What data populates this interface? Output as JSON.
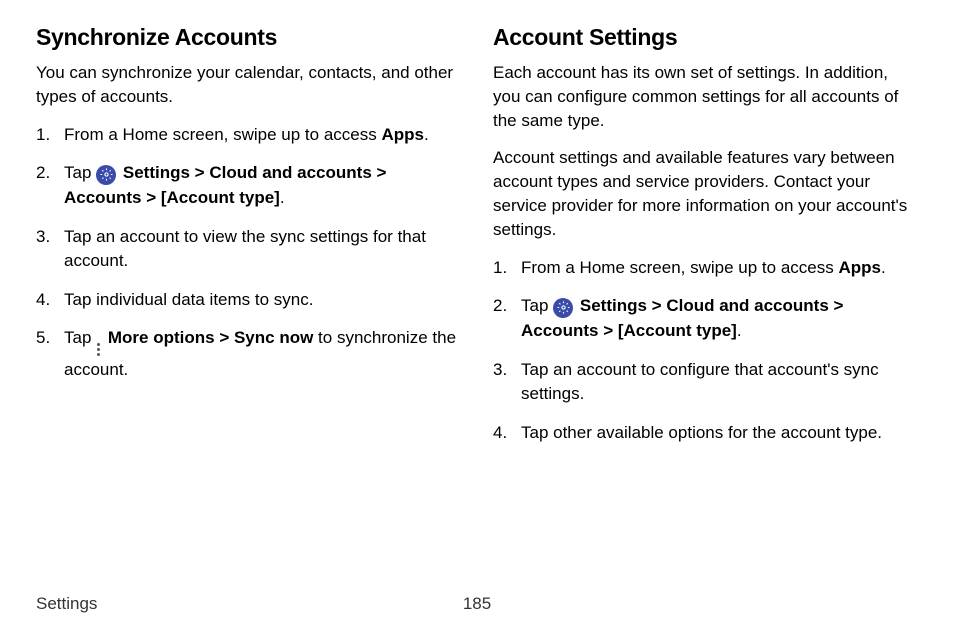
{
  "left": {
    "heading": "Synchronize Accounts",
    "intro": "You can synchronize your calendar, contacts, and other types of accounts.",
    "steps": {
      "s1_pre": "From a Home screen, swipe up to access ",
      "s1_bold": "Apps",
      "s1_post": ".",
      "s2_pre": "Tap ",
      "s2_settings": "Settings",
      "s2_sep1": " > ",
      "s2_cloud": "Cloud and accounts",
      "s2_sep2": " > ",
      "s2_accounts": "Accounts",
      "s2_sep3": " > ",
      "s2_type": "[Account type]",
      "s2_post": ".",
      "s3": "Tap an account to view the sync settings for that account.",
      "s4": "Tap individual data items to sync.",
      "s5_pre": "Tap ",
      "s5_more": "More options",
      "s5_sep": " > ",
      "s5_sync": "Sync now",
      "s5_post": " to synchronize the account."
    }
  },
  "right": {
    "heading": "Account Settings",
    "intro1": "Each account has its own set of settings. In addition, you can configure common settings for all accounts of the same type.",
    "intro2": "Account settings and available features vary between account types and service providers. Contact your service provider for more information on your account's settings.",
    "steps": {
      "s1_pre": "From a Home screen, swipe up to access ",
      "s1_bold": "Apps",
      "s1_post": ".",
      "s2_pre": "Tap ",
      "s2_settings": "Settings",
      "s2_sep1": " > ",
      "s2_cloud": "Cloud and accounts",
      "s2_sep2": " > ",
      "s2_accounts": "Accounts",
      "s2_sep3": " > ",
      "s2_type": "[Account type]",
      "s2_post": ".",
      "s3": "Tap an account to configure that account's sync settings.",
      "s4": "Tap other available options for the account type."
    }
  },
  "footer": {
    "label": "Settings",
    "page": "185"
  }
}
